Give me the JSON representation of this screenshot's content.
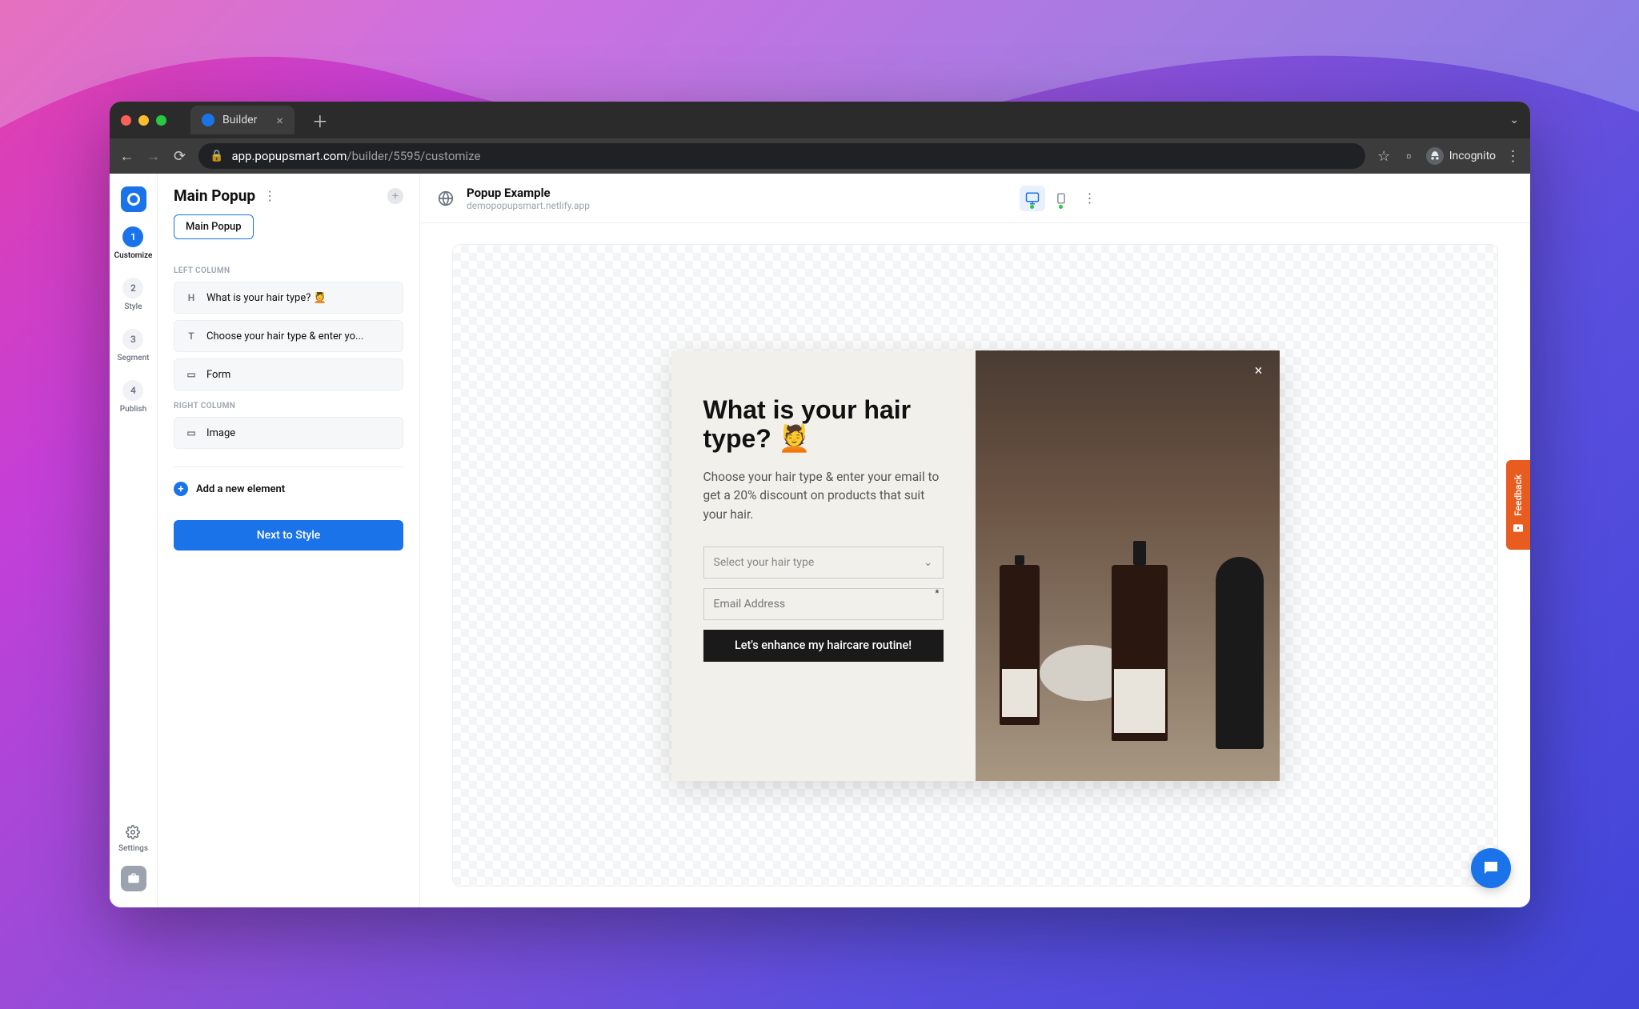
{
  "browser": {
    "tab_title": "Builder",
    "url_host": "app.popupsmart.com",
    "url_path": "/builder/5595/customize",
    "incognito_label": "Incognito"
  },
  "rail": {
    "steps": [
      {
        "num": "1",
        "label": "Customize",
        "active": true
      },
      {
        "num": "2",
        "label": "Style",
        "active": false
      },
      {
        "num": "3",
        "label": "Segment",
        "active": false
      },
      {
        "num": "4",
        "label": "Publish",
        "active": false
      }
    ],
    "settings_label": "Settings"
  },
  "sidebar": {
    "title": "Main Popup",
    "chip": "Main Popup",
    "left_column_label": "LEFT COLUMN",
    "right_column_label": "RIGHT COLUMN",
    "left_items": [
      {
        "icon": "H",
        "text": "What is your hair type? 💆"
      },
      {
        "icon": "T",
        "text": "Choose your hair type &amp; enter yo..."
      },
      {
        "icon": "▭",
        "text": "Form"
      }
    ],
    "right_items": [
      {
        "icon": "▭",
        "text": "Image"
      }
    ],
    "add_element": "Add a new element",
    "next_btn": "Next to Style"
  },
  "header": {
    "project_name": "Popup Example",
    "project_sub": "demopopupsmart.netlify.app"
  },
  "popup": {
    "title": "What is your hair type? 💆",
    "desc": "Choose your hair type & enter your email to get a 20% discount on products that suit your hair.",
    "select_placeholder": "Select your hair type",
    "email_placeholder": "Email Address",
    "cta": "Let's enhance my haircare routine!"
  },
  "feedback": {
    "label": "Feedback"
  }
}
